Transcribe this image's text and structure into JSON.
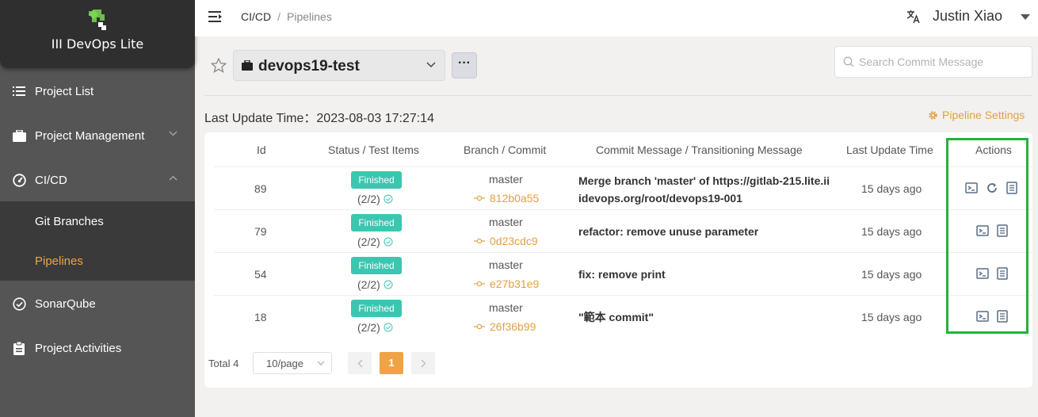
{
  "sidebar": {
    "logo_text": "III DevOps Lite",
    "items": [
      {
        "label": "Project List",
        "icon": "list-icon"
      },
      {
        "label": "Project Management",
        "icon": "briefcase-icon"
      },
      {
        "label": "CI/CD",
        "icon": "gauge-icon"
      },
      {
        "label": "SonarQube",
        "icon": "check-circle-icon"
      },
      {
        "label": "Project Activities",
        "icon": "clipboard-icon"
      }
    ],
    "sub_items": [
      {
        "label": "Git Branches"
      },
      {
        "label": "Pipelines",
        "active": true
      }
    ]
  },
  "header": {
    "breadcrumb_root": "CI/CD",
    "breadcrumb_sep": "/",
    "breadcrumb_current": "Pipelines",
    "user_name": "Justin Xiao"
  },
  "project": {
    "name": "devops19-test",
    "more_label": "···"
  },
  "search": {
    "placeholder": "Search Commit Message"
  },
  "last_update": "Last Update Time：2023-08-03 17:27:14",
  "pipeline_settings_label": "Pipeline Settings",
  "table": {
    "headers": [
      "Id",
      "Status / Test Items",
      "Branch / Commit",
      "Commit Message / Transitioning Message",
      "Last Update Time",
      "Actions"
    ],
    "rows": [
      {
        "id": "89",
        "status": "Finished",
        "tests": "(2/2)",
        "branch": "master",
        "commit": "812b0a55",
        "message_line1": "Merge branch 'master' of https://gitlab-215.lite.ii",
        "message_line2": "idevops.org/root/devops19-001",
        "updated": "15 days ago",
        "rerun": true
      },
      {
        "id": "79",
        "status": "Finished",
        "tests": "(2/2)",
        "branch": "master",
        "commit": "0d23cdc9",
        "message_line1": "refactor: remove unuse parameter",
        "message_line2": "",
        "updated": "15 days ago",
        "rerun": false
      },
      {
        "id": "54",
        "status": "Finished",
        "tests": "(2/2)",
        "branch": "master",
        "commit": "e27b31e9",
        "message_line1": "fix: remove print",
        "message_line2": "",
        "updated": "15 days ago",
        "rerun": false
      },
      {
        "id": "18",
        "status": "Finished",
        "tests": "(2/2)",
        "branch": "master",
        "commit": "26f36b99",
        "message_line1": "\"範本 commit\"",
        "message_line2": "",
        "updated": "15 days ago",
        "rerun": false
      }
    ]
  },
  "pagination": {
    "total": "Total 4",
    "page_size": "10/page",
    "current_page": "1"
  },
  "colors": {
    "accent": "#f0a345",
    "badge": "#3cc6b0",
    "highlight": "#22b33a"
  }
}
